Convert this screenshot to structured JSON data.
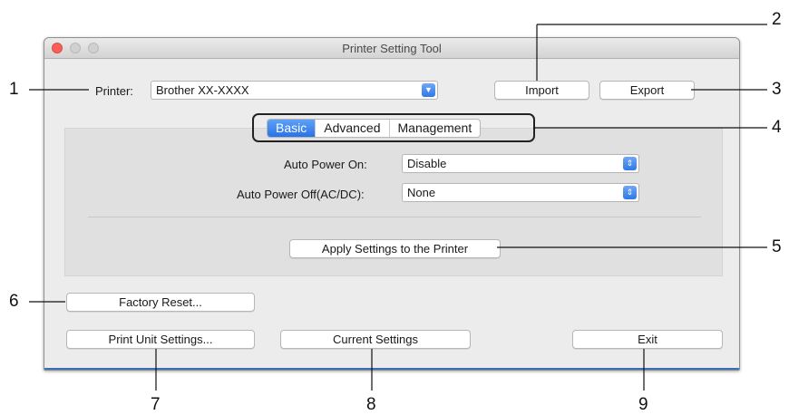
{
  "window": {
    "title": "Printer Setting Tool"
  },
  "printer": {
    "label": "Printer:",
    "selected": "Brother XX-XXXX"
  },
  "buttons": {
    "import": "Import",
    "export": "Export",
    "apply": "Apply Settings to the Printer",
    "factory_reset": "Factory Reset...",
    "print_unit": "Print Unit Settings...",
    "current": "Current Settings",
    "exit": "Exit"
  },
  "tabs": [
    {
      "label": "Basic",
      "selected": true
    },
    {
      "label": "Advanced",
      "selected": false
    },
    {
      "label": "Management",
      "selected": false
    }
  ],
  "settings": {
    "auto_power_on": {
      "label": "Auto Power On:",
      "value": "Disable"
    },
    "auto_power_off": {
      "label": "Auto Power Off(AC/DC):",
      "value": "None"
    }
  },
  "callouts": [
    "1",
    "2",
    "3",
    "4",
    "5",
    "6",
    "7",
    "8",
    "9"
  ],
  "colors": {
    "accent": "#2f78e8",
    "close": "#fc5f57"
  }
}
